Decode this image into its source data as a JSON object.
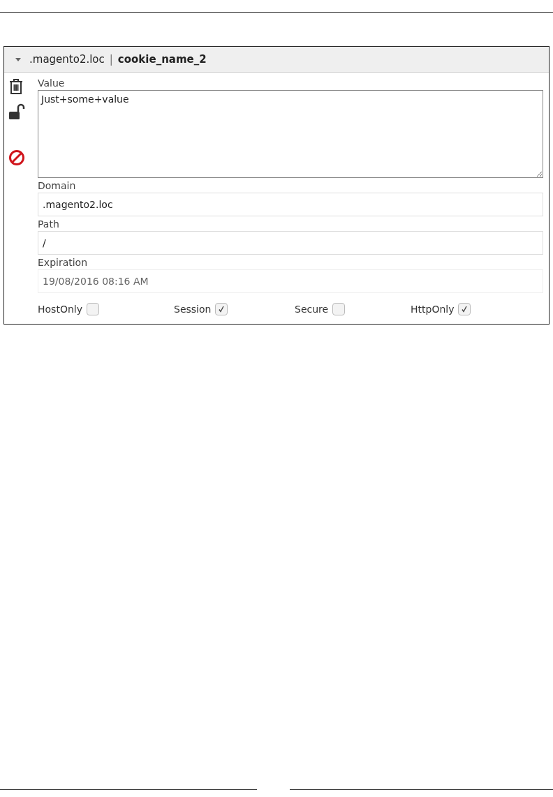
{
  "cookie_header": {
    "expanded": true,
    "domain": ".magento2.loc",
    "separator": "|",
    "name": "cookie_name_2"
  },
  "value_field": {
    "label": "Value",
    "value": "Just+some+value"
  },
  "fields": [
    {
      "label": "Domain",
      "value": ".magento2.loc",
      "disabled": false
    },
    {
      "label": "Path",
      "value": "/",
      "disabled": false
    },
    {
      "label": "Expiration",
      "value": "19/08/2016 08:16 AM",
      "disabled": true
    }
  ],
  "flags": [
    {
      "label": "HostOnly",
      "checked": false
    },
    {
      "label": "Session",
      "checked": true
    },
    {
      "label": "Secure",
      "checked": false
    },
    {
      "label": "HttpOnly",
      "checked": true
    }
  ]
}
